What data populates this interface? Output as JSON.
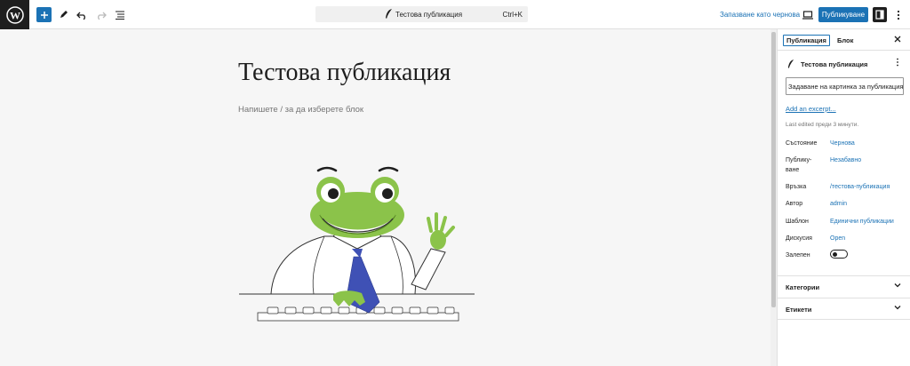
{
  "toolbar": {
    "command_title": "Тестова публикация",
    "command_shortcut": "Ctrl+K",
    "save_draft_label": "Запазване като чернова",
    "publish_label": "Публикуване"
  },
  "editor": {
    "post_title": "Тестова публикация",
    "block_placeholder": "Напишете / за да изберете блок"
  },
  "sidebar": {
    "tabs": [
      "Публикация",
      "Блок"
    ],
    "post_title": "Тестова публикация",
    "featured_image_label": "Задаване на картинка за публикацията",
    "add_excerpt": "Add an excerpt...",
    "last_edited": "Last edited преди 3 минути.",
    "properties": [
      {
        "label": "Състояние",
        "value": "Чернова"
      },
      {
        "label": "Публику-\nване",
        "value": "Незабавно"
      },
      {
        "label": "Връзка",
        "value": "/тестова-публикация"
      },
      {
        "label": "Автор",
        "value": "admin"
      },
      {
        "label": "Шаблон",
        "value": "Единични публикации"
      },
      {
        "label": "Дискусия",
        "value": "Open"
      },
      {
        "label": "Залепен",
        "value": ""
      }
    ],
    "sticky_toggle_on": false,
    "panels": [
      "Категории",
      "Етикети"
    ]
  },
  "colors": {
    "accent": "#1b72b5",
    "frog_green": "#8bc34a",
    "tie_blue": "#3f51b5"
  },
  "icons": {
    "logo": "wordpress-logo-icon",
    "add": "plus-icon",
    "tools": "pencil-icon",
    "undo": "undo-icon",
    "redo": "redo-icon",
    "outline": "list-view-icon",
    "view": "desktop-preview-icon",
    "settings": "sidebar-toggle-icon",
    "options": "vertical-ellipsis-icon"
  }
}
